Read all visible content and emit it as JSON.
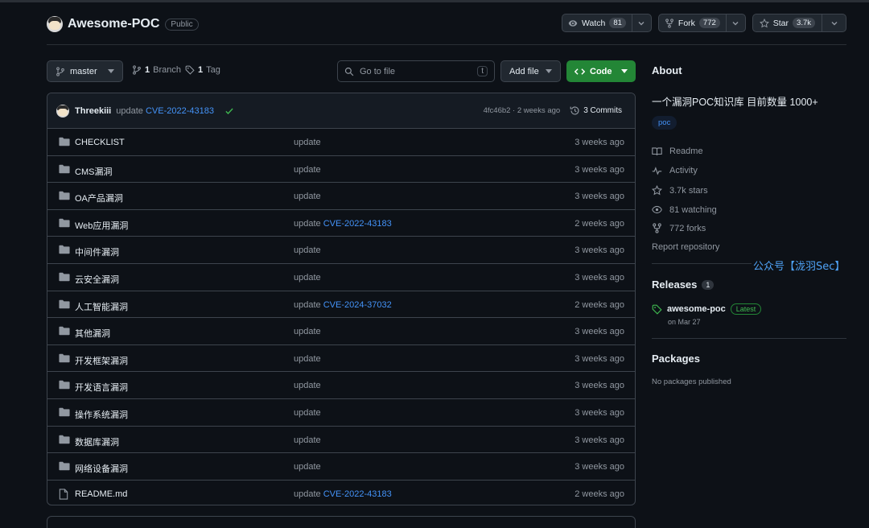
{
  "repo": {
    "name": "Awesome-POC",
    "visibility": "Public"
  },
  "actions": {
    "watch_label": "Watch",
    "watch_count": "81",
    "fork_label": "Fork",
    "fork_count": "772",
    "star_label": "Star",
    "star_count": "3.7k"
  },
  "toolbar": {
    "branch": "master",
    "branches_count": "1",
    "branches_label": "Branch",
    "tags_count": "1",
    "tags_label": "Tag",
    "search_placeholder": "Go to file",
    "search_key": "t",
    "add_file_label": "Add file",
    "code_label": "Code"
  },
  "latest_commit": {
    "author": "Threekiii",
    "message_prefix": "update",
    "message_link": "CVE-2022-43183",
    "hash_time": "4fc46b2 · 2 weeks ago",
    "commits_label": "3 Commits"
  },
  "files": [
    {
      "name": "CHECKLIST",
      "type": "folder",
      "msg": "update",
      "link": "",
      "time": "3 weeks ago"
    },
    {
      "name": "CMS漏洞",
      "type": "folder",
      "msg": "update",
      "link": "",
      "time": "3 weeks ago"
    },
    {
      "name": "OA产品漏洞",
      "type": "folder",
      "msg": "update",
      "link": "",
      "time": "3 weeks ago"
    },
    {
      "name": "Web应用漏洞",
      "type": "folder",
      "msg": "update",
      "link": "CVE-2022-43183",
      "time": "2 weeks ago"
    },
    {
      "name": "中间件漏洞",
      "type": "folder",
      "msg": "update",
      "link": "",
      "time": "3 weeks ago"
    },
    {
      "name": "云安全漏洞",
      "type": "folder",
      "msg": "update",
      "link": "",
      "time": "3 weeks ago"
    },
    {
      "name": "人工智能漏洞",
      "type": "folder",
      "msg": "update",
      "link": "CVE-2024-37032",
      "time": "2 weeks ago"
    },
    {
      "name": "其他漏洞",
      "type": "folder",
      "msg": "update",
      "link": "",
      "time": "3 weeks ago"
    },
    {
      "name": "开发框架漏洞",
      "type": "folder",
      "msg": "update",
      "link": "",
      "time": "3 weeks ago"
    },
    {
      "name": "开发语言漏洞",
      "type": "folder",
      "msg": "update",
      "link": "",
      "time": "3 weeks ago"
    },
    {
      "name": "操作系统漏洞",
      "type": "folder",
      "msg": "update",
      "link": "",
      "time": "3 weeks ago"
    },
    {
      "name": "数据库漏洞",
      "type": "folder",
      "msg": "update",
      "link": "",
      "time": "3 weeks ago"
    },
    {
      "name": "网络设备漏洞",
      "type": "folder",
      "msg": "update",
      "link": "",
      "time": "3 weeks ago"
    },
    {
      "name": "README.md",
      "type": "file",
      "msg": "update",
      "link": "CVE-2022-43183",
      "time": "2 weeks ago"
    }
  ],
  "about": {
    "title": "About",
    "description": "一个漏洞POC知识库 目前数量 1000+",
    "topic": "poc",
    "readme": "Readme",
    "activity": "Activity",
    "stars": "3.7k stars",
    "watching": "81 watching",
    "forks": "772 forks",
    "report": "Report repository"
  },
  "watermark": "公众号【泷羽Sec】",
  "releases": {
    "title": "Releases",
    "count": "1",
    "name": "awesome-poc",
    "badge": "Latest",
    "date": "on Mar 27"
  },
  "packages": {
    "title": "Packages",
    "empty": "No packages published"
  },
  "colors": {
    "background": "#0d1117",
    "accent_green": "#238636",
    "link_blue": "#4493f8"
  }
}
